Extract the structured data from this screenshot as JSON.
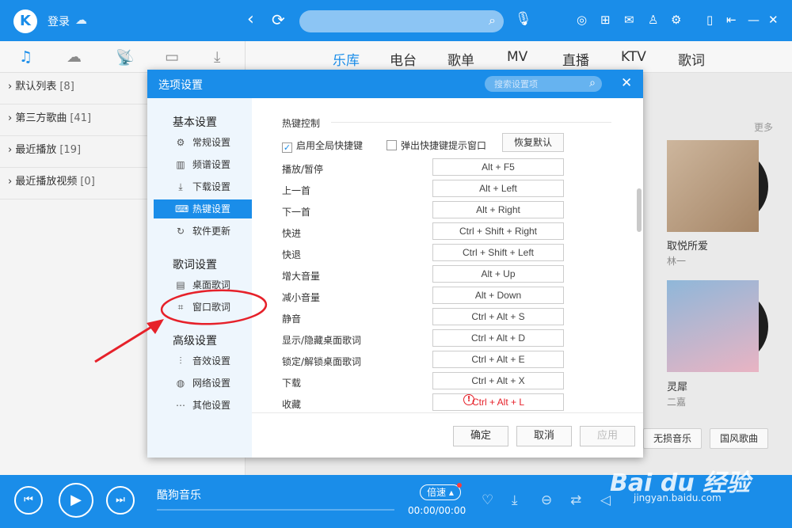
{
  "app": {
    "logo_letter": "K",
    "login": "登录"
  },
  "tabs": [
    "乐库",
    "电台",
    "歌单",
    "MV",
    "直播",
    "KTV",
    "歌词"
  ],
  "sidebar": {
    "items": [
      {
        "label": "默认列表",
        "count": "[8]"
      },
      {
        "label": "第三方歌曲",
        "count": "[41]"
      },
      {
        "label": "最近播放",
        "count": "[19]"
      },
      {
        "label": "最近播放视频",
        "count": "[0]"
      }
    ]
  },
  "content": {
    "more": "更多",
    "albums": [
      {
        "title": "取悦所爱",
        "artist": "林一"
      },
      {
        "title": "灵犀",
        "artist": "二嘉"
      }
    ],
    "tags": [
      "无损音乐",
      "国风歌曲"
    ]
  },
  "player": {
    "song": "酷狗音乐",
    "speed": "倍速",
    "time": "00:00/00:00"
  },
  "dialog": {
    "title": "选项设置",
    "search_placeholder": "搜索设置项",
    "groups": [
      {
        "title": "基本设置",
        "items": [
          {
            "label": "常规设置",
            "icon": "gear-icon"
          },
          {
            "label": "频谱设置",
            "icon": "equalizer-icon"
          },
          {
            "label": "下载设置",
            "icon": "download-icon"
          },
          {
            "label": "热键设置",
            "icon": "keyboard-icon",
            "active": true
          },
          {
            "label": "软件更新",
            "icon": "update-icon"
          }
        ]
      },
      {
        "title": "歌词设置",
        "items": [
          {
            "label": "桌面歌词",
            "icon": "desktop-lyric-icon"
          },
          {
            "label": "窗口歌词",
            "icon": "window-lyric-icon"
          }
        ]
      },
      {
        "title": "高级设置",
        "items": [
          {
            "label": "音效设置",
            "icon": "sound-effect-icon"
          },
          {
            "label": "网络设置",
            "icon": "network-icon"
          },
          {
            "label": "其他设置",
            "icon": "more-icon"
          }
        ]
      }
    ],
    "section": "热键控制",
    "enable_global": {
      "label": "启用全局快捷键",
      "checked": true
    },
    "popup_hint": {
      "label": "弹出快捷键提示窗口",
      "checked": false
    },
    "restore": "恢复默认",
    "hotkeys": [
      {
        "label": "播放/暂停",
        "key": "Alt + F5"
      },
      {
        "label": "上一首",
        "key": "Alt + Left"
      },
      {
        "label": "下一首",
        "key": "Alt + Right"
      },
      {
        "label": "快进",
        "key": "Ctrl + Shift + Right"
      },
      {
        "label": "快退",
        "key": "Ctrl + Shift + Left"
      },
      {
        "label": "增大音量",
        "key": "Alt + Up"
      },
      {
        "label": "减小音量",
        "key": "Alt + Down"
      },
      {
        "label": "静音",
        "key": "Ctrl + Alt + S"
      },
      {
        "label": "显示/隐藏桌面歌词",
        "key": "Ctrl + Alt + D"
      },
      {
        "label": "锁定/解锁桌面歌词",
        "key": "Ctrl + Alt + E"
      },
      {
        "label": "下载",
        "key": "Ctrl + Alt + X"
      },
      {
        "label": "收藏",
        "key": "Ctrl + Alt + L",
        "conflict": true
      }
    ],
    "buttons": {
      "ok": "确定",
      "cancel": "取消",
      "apply": "应用"
    }
  },
  "watermark": {
    "brand": "Bai du 经验",
    "site": "jingyan.baidu.com"
  },
  "colors": {
    "accent": "#1a8de9",
    "annotation": "#e6212a",
    "error": "#e6212a"
  }
}
